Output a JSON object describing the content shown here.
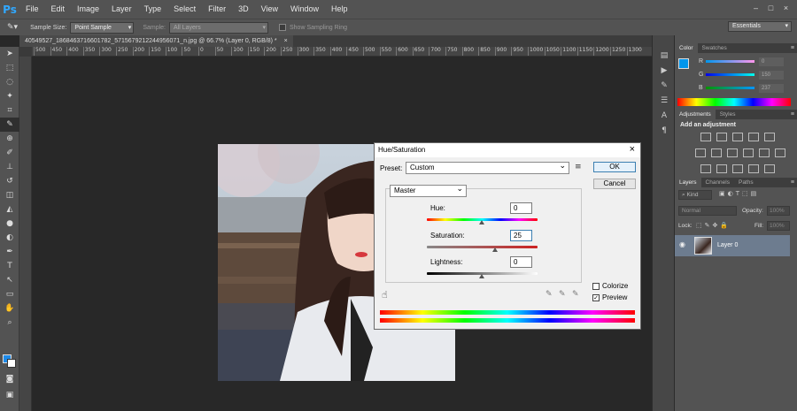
{
  "menubar": {
    "logo": "Ps",
    "items": [
      "File",
      "Edit",
      "Image",
      "Layer",
      "Type",
      "Select",
      "Filter",
      "3D",
      "View",
      "Window",
      "Help"
    ],
    "window_controls": [
      "–",
      "□",
      "×"
    ]
  },
  "optionsbar": {
    "sample_size_label": "Sample Size:",
    "sample_size_value": "Point Sample",
    "sample_label": "Sample:",
    "sample_value": "All Layers",
    "show_ring_label": "Show Sampling Ring",
    "workspace": "Essentials"
  },
  "document": {
    "tab_title": "40549527_1868463716601782_5715679212244956071_n.jpg @ 66.7% (Layer 0, RGB/8) *",
    "close": "×"
  },
  "ruler": {
    "ticks": [
      "500",
      "450",
      "400",
      "350",
      "300",
      "250",
      "200",
      "150",
      "100",
      "50",
      "0",
      "50",
      "100",
      "150",
      "200",
      "250",
      "300",
      "350",
      "400",
      "450",
      "500",
      "550",
      "600",
      "650",
      "700",
      "750",
      "800",
      "850",
      "900",
      "950",
      "1000",
      "1050",
      "1100",
      "1150",
      "1200",
      "1250",
      "1300"
    ]
  },
  "dialog": {
    "title": "Hue/Saturation",
    "close": "×",
    "preset_label": "Preset:",
    "preset_value": "Custom",
    "channel_value": "Master",
    "hue_label": "Hue:",
    "hue_value": "0",
    "saturation_label": "Saturation:",
    "saturation_value": "25",
    "lightness_label": "Lightness:",
    "lightness_value": "0",
    "ok_label": "OK",
    "cancel_label": "Cancel",
    "colorize_label": "Colorize",
    "colorize_checked": false,
    "preview_label": "Preview",
    "preview_checked": true,
    "preview_check_mark": "✓"
  },
  "color_panel": {
    "tabs": [
      "Color",
      "Swatches"
    ],
    "r_label": "R",
    "r_value": "0",
    "g_label": "G",
    "g_value": "150",
    "b_label": "B",
    "b_value": "237",
    "foreground": "#0096ed"
  },
  "adjustments_panel": {
    "tabs": [
      "Adjustments",
      "Styles"
    ],
    "heading": "Add an adjustment"
  },
  "layers_panel": {
    "tabs": [
      "Layers",
      "Channels",
      "Paths"
    ],
    "filter_value": "Kind",
    "blend_mode": "Normal",
    "opacity_label": "Opacity:",
    "opacity_value": "100%",
    "lock_label": "Lock:",
    "fill_label": "Fill:",
    "fill_value": "100%",
    "layer_name": "Layer 0"
  },
  "colors": {
    "accent": "#31a8ff",
    "foreground_swatch": "#1e8ae8"
  }
}
